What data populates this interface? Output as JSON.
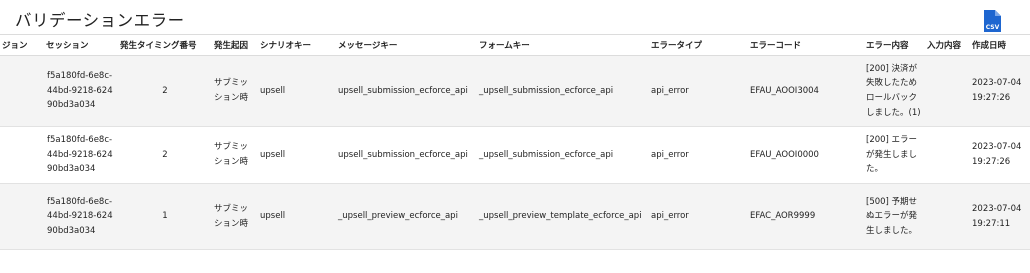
{
  "page": {
    "title": "バリデーションエラー",
    "csv_icon_label": "CSV"
  },
  "table": {
    "headers": [
      "ジョン",
      "セッション",
      "発生タイミング番号",
      "発生起因",
      "シナリオキー",
      "メッセージキー",
      "フォームキー",
      "エラータイプ",
      "エラーコード",
      "エラー内容",
      "入力内容",
      "作成日時"
    ],
    "rows": [
      {
        "version": "",
        "session": "f5a180fd-6e8c-44bd-9218-62490bd3a034",
        "timing": "2",
        "cause": "サブミッション時",
        "scenario": "upsell",
        "message_key": "upsell_submission_ecforce_api",
        "form_key": "_upsell_submission_ecforce_api",
        "error_type": "api_error",
        "error_code": "EFAU_AOOI3004",
        "error_content": "[200] 決済が失敗したためロールバックしました。(1)",
        "input": "",
        "created_at": "2023-07-04 19:27:26"
      },
      {
        "version": "",
        "session": "f5a180fd-6e8c-44bd-9218-62490bd3a034",
        "timing": "2",
        "cause": "サブミッション時",
        "scenario": "upsell",
        "message_key": "upsell_submission_ecforce_api",
        "form_key": "_upsell_submission_ecforce_api",
        "error_type": "api_error",
        "error_code": "EFAU_AOOI0000",
        "error_content": "[200] エラーが発生しました。",
        "input": "",
        "created_at": "2023-07-04 19:27:26"
      },
      {
        "version": "",
        "session": "f5a180fd-6e8c-44bd-9218-62490bd3a034",
        "timing": "1",
        "cause": "サブミッション時",
        "scenario": "upsell",
        "message_key": "_upsell_preview_ecforce_api",
        "form_key": "_upsell_preview_template_ecforce_api",
        "error_type": "api_error",
        "error_code": "EFAC_AOR9999",
        "error_content": "[500] 予期せぬエラーが発生しました。",
        "input": "",
        "created_at": "2023-07-04 19:27:11"
      }
    ]
  },
  "colors": {
    "csv_icon": "#1e66d0",
    "header_border": "#dcdcdc",
    "row_odd_bg": "#f4f4f4"
  }
}
